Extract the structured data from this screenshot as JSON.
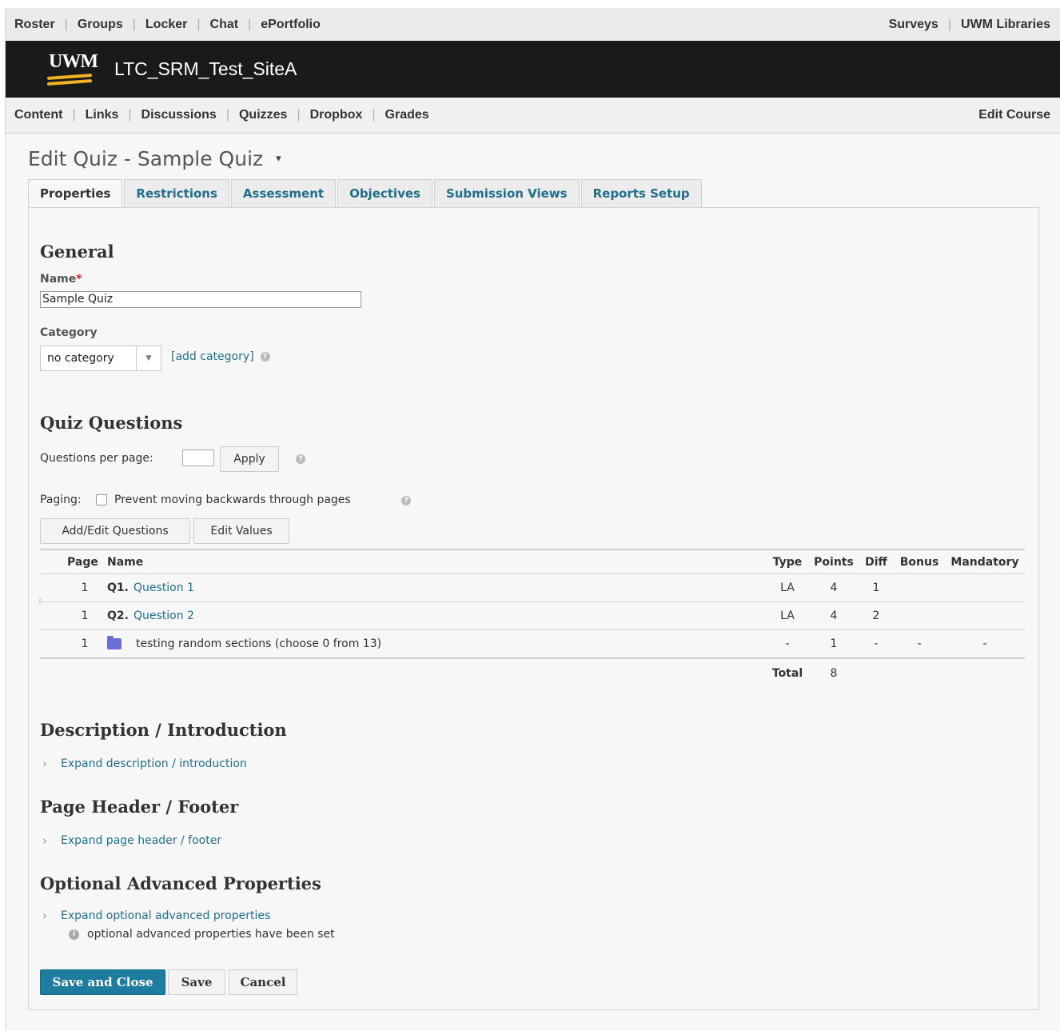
{
  "topnav": {
    "left": [
      "Roster",
      "Groups",
      "Locker",
      "Chat",
      "ePortfolio"
    ],
    "right": [
      "Surveys",
      "UWM Libraries"
    ]
  },
  "banner": {
    "logo_text": "UWM",
    "site_title": "LTC_SRM_Test_SiteA"
  },
  "coursenav": {
    "left": [
      "Content",
      "Links",
      "Discussions",
      "Quizzes",
      "Dropbox",
      "Grades"
    ],
    "right": "Edit Course"
  },
  "page": {
    "title": "Edit Quiz - Sample Quiz",
    "caret": "▾"
  },
  "tabs": [
    "Properties",
    "Restrictions",
    "Assessment",
    "Objectives",
    "Submission Views",
    "Reports Setup"
  ],
  "general": {
    "heading": "General",
    "name_label": "Name",
    "required_mark": "*",
    "name_value": "Sample Quiz",
    "category_label": "Category",
    "category_value": "no category",
    "add_category": "[add category]"
  },
  "quiz_questions": {
    "heading": "Quiz Questions",
    "qpp_label": "Questions per page:",
    "qpp_value": "",
    "apply": "Apply",
    "paging_label": "Paging:",
    "prevent_back": "Prevent moving backwards through pages",
    "prevent_back_checked": false,
    "add_edit": "Add/Edit Questions",
    "edit_values": "Edit Values",
    "columns": {
      "page": "Page",
      "name": "Name",
      "type": "Type",
      "points": "Points",
      "diff": "Diff",
      "bonus": "Bonus",
      "mandatory": "Mandatory"
    },
    "rows": [
      {
        "page": "1",
        "id": "Q1.",
        "name": "Question 1",
        "type": "LA",
        "points": "4",
        "diff": "1",
        "bonus": "",
        "mandatory": ""
      },
      {
        "page": "1",
        "id": "Q2.",
        "name": "Question 2",
        "type": "LA",
        "points": "4",
        "diff": "2",
        "bonus": "",
        "mandatory": ""
      },
      {
        "page": "1",
        "id": "",
        "name": "testing random sections (choose 0 from 13)",
        "type": "-",
        "points": "1",
        "diff": "-",
        "bonus": "-",
        "mandatory": "-"
      }
    ],
    "total_label": "Total",
    "total_value": "8"
  },
  "description": {
    "heading": "Description / Introduction",
    "expand": "Expand description / introduction"
  },
  "header_footer": {
    "heading": "Page Header / Footer",
    "expand": "Expand page header / footer"
  },
  "advanced": {
    "heading": "Optional Advanced Properties",
    "expand": "Expand optional advanced properties",
    "note": "optional advanced properties have been set"
  },
  "actions": {
    "save_close": "Save and Close",
    "save": "Save",
    "cancel": "Cancel"
  },
  "colors": {
    "link": "#1f6e8c",
    "primary": "#1e7c9f",
    "banner": "#1a1a1a",
    "logo_gold": "#f0b323"
  }
}
